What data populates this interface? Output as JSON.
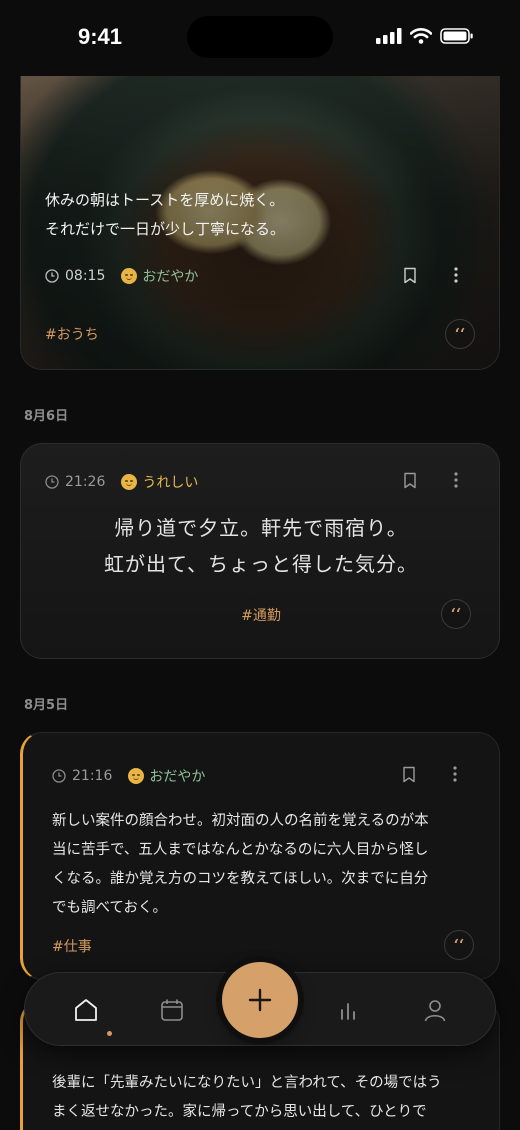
{
  "status_bar": {
    "time": "9:41"
  },
  "entries": [
    {
      "lines": [
        "休みの朝はトーストを厚めに焼く。",
        "それだけで一日が少し丁寧になる。"
      ],
      "time": "08:15",
      "mood": "おだやか",
      "tag": "#おうち",
      "quote_symbol": "‘‘"
    },
    {
      "date": "8月6日",
      "time": "21:26",
      "mood": "うれしい",
      "lines": [
        "帰り道で夕立。軒先で雨宿り。",
        "虹が出て、ちょっと得した気分。"
      ],
      "tag": "#通勤",
      "quote_symbol": "‘‘"
    },
    {
      "date": "8月5日",
      "time": "21:16",
      "mood": "おだやか",
      "lines": [
        "新しい案件の顔合わせ。初対面の人の名前を覚えるのが本",
        "当に苦手で、五人まではなんとかなるのに六人目から怪し",
        "くなる。誰か覚え方のコツを教えてほしい。次までに自分",
        "でも調べておく。"
      ],
      "tag": "#仕事",
      "quote_symbol": "‘‘"
    },
    {
      "lines": [
        "後輩に「先輩みたいになりたい」と言われて、その場ではう",
        "まく返せなかった。家に帰ってから思い出して、ひとりで"
      ]
    }
  ],
  "nav": {
    "items": [
      "home",
      "calendar",
      "add",
      "stats",
      "profile"
    ],
    "active": "home",
    "accent": "#d6a06a"
  }
}
